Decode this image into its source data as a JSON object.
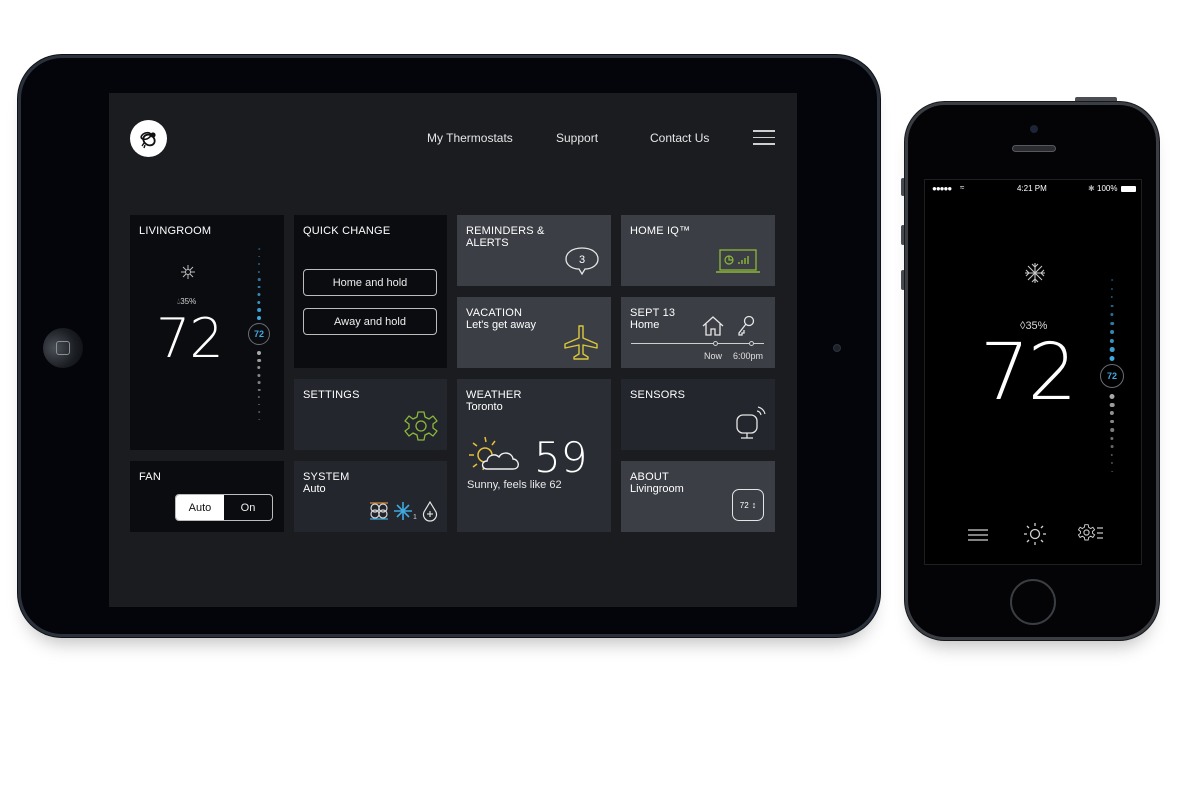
{
  "colors": {
    "accent_blue": "#3fa9e0",
    "accent_green": "#8cb83a",
    "accent_yellow": "#d9c93a",
    "tile_dark": "#0b0c0f",
    "tile_mid": "#23262d",
    "tile_grey": "#3b3e44",
    "screen_bg": "#1b1c20"
  },
  "tablet": {
    "header": {
      "logo_icon": "bee-logo-icon",
      "nav": [
        "My Thermostats",
        "Support",
        "Contact Us"
      ],
      "menu_icon": "hamburger-menu-icon"
    },
    "tiles": {
      "livingroom": {
        "title": "LIVINGROOM",
        "mode_icon": "snowflake-icon",
        "humidity": "35%",
        "temperature": "72",
        "setpoint": "72",
        "dial": {
          "cool_dots": 10,
          "heat_dots": 10
        }
      },
      "quick_change": {
        "title": "QUICK CHANGE",
        "buttons": [
          "Home and hold",
          "Away and hold"
        ]
      },
      "reminders": {
        "title": "REMINDERS &",
        "title2": "ALERTS",
        "count": "3"
      },
      "home_iq": {
        "title": "HOME IQ™"
      },
      "vacation": {
        "title": "VACATION",
        "subtitle": "Let's get away"
      },
      "schedule": {
        "title": "SEPT 13",
        "subtitle": "Home",
        "labels": [
          "Now",
          "6:00pm"
        ]
      },
      "settings": {
        "title": "SETTINGS"
      },
      "weather": {
        "title": "WEATHER",
        "city": "Toronto",
        "temperature": "59",
        "description": "Sunny, feels like 62"
      },
      "sensors": {
        "title": "SENSORS"
      },
      "fan": {
        "title": "FAN",
        "options": [
          "Auto",
          "On"
        ],
        "selected": "Auto"
      },
      "system": {
        "title": "SYSTEM",
        "mode": "Auto",
        "stage_count": "1"
      },
      "about": {
        "title": "ABOUT",
        "name": "Livingroom",
        "badge": "72"
      }
    }
  },
  "phone": {
    "status_bar": {
      "time": "4:21 PM",
      "battery": "100%"
    },
    "humidity": "35%",
    "temperature": "72",
    "setpoint": "72",
    "bottom_icons": [
      "hamburger-menu-icon",
      "sun-icon",
      "settings-list-icon"
    ]
  }
}
